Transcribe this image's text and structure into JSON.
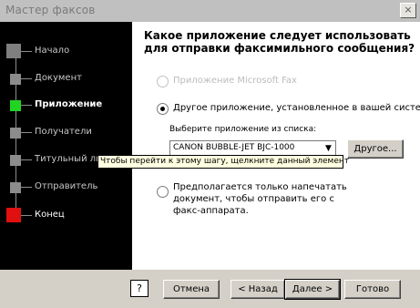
{
  "window": {
    "title": "Мастер факсов",
    "close_glyph": "×"
  },
  "steps": [
    {
      "label": "Начало",
      "state": "done"
    },
    {
      "label": "Документ",
      "state": "pending"
    },
    {
      "label": "Приложение",
      "state": "current"
    },
    {
      "label": "Получатели",
      "state": "pending"
    },
    {
      "label": "Титульный лист",
      "state": "pending"
    },
    {
      "label": "Отправитель",
      "state": "pending"
    },
    {
      "label": "Конец",
      "state": "final"
    }
  ],
  "main": {
    "heading": "Какое приложение следует использовать для отправки факсимильного сообщения?",
    "options": [
      {
        "label": "Приложение Microsoft Fax",
        "enabled": false,
        "selected": false
      },
      {
        "label": "Другое приложение, установленное в вашей системе",
        "enabled": true,
        "selected": true
      },
      {
        "label": "Предполагается только напечатать документ, чтобы отправить его с факс-аппарата.",
        "enabled": true,
        "selected": false
      }
    ],
    "choose_label": "Выберите приложение из списка:",
    "combo_value": "CANON BUBBLE-JET BJC-1000",
    "other_button": "Другое..."
  },
  "tooltip": "Чтобы перейти к этому шагу, щелкните данный элемент",
  "buttons": {
    "help_glyph": "?",
    "cancel": "Отмена",
    "back": "< Назад",
    "next": "Далее >",
    "finish": "Готово"
  },
  "colors": {
    "done_step": "#7f7f7f",
    "current_step": "#22d422",
    "final_step": "#e01010",
    "left_panel": "#000000",
    "tooltip_bg": "#ffffe1"
  }
}
